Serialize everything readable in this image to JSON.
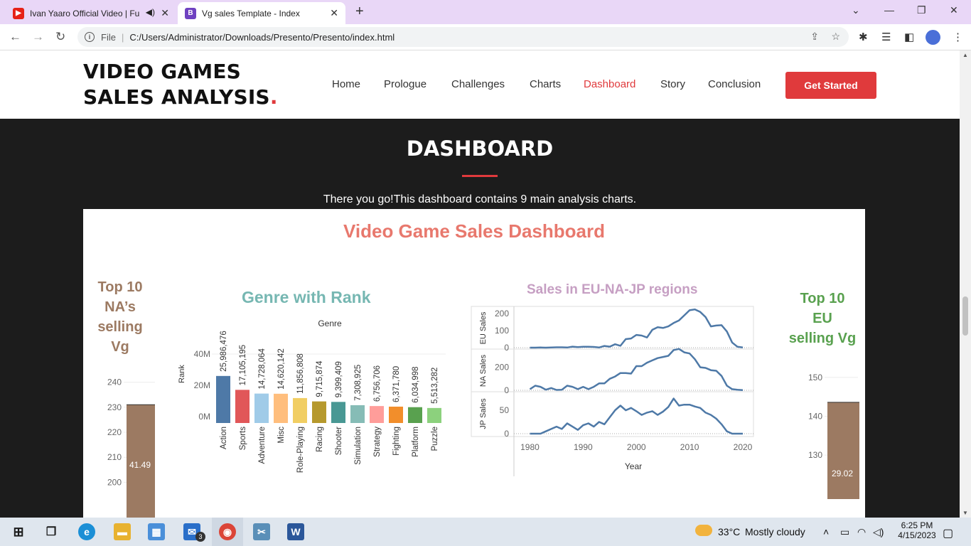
{
  "browser": {
    "tabs": [
      {
        "title": "Ivan Yaaro Official Video | Fu",
        "icon": "youtube-icon",
        "muted_icon": "speaker-icon",
        "active": false
      },
      {
        "title": "Vg sales Template - Index",
        "icon": "bootstrap-icon",
        "icon_letter": "B",
        "active": true
      }
    ],
    "new_tab": "+",
    "address": {
      "scheme_label": "File",
      "url": "C:/Users/Administrator/Downloads/Presento/Presento/index.html"
    }
  },
  "site": {
    "logo_text": "VIDEO GAMES SALES ANALYSIS",
    "logo_dot": ".",
    "nav": [
      {
        "label": "Home",
        "active": false
      },
      {
        "label": "Prologue",
        "active": false
      },
      {
        "label": "Challenges",
        "active": false
      },
      {
        "label": "Charts",
        "active": false
      },
      {
        "label": "Dashboard",
        "active": true
      },
      {
        "label": "Story",
        "active": false
      },
      {
        "label": "Conclusion",
        "active": false
      }
    ],
    "cta_label": "Get Started",
    "section": {
      "title": "DASHBOARD",
      "subtitle": "There you go!This dashboard contains 9 main analysis charts."
    }
  },
  "dashboard": {
    "title": "Video Game Sales Dashboard",
    "colors": {
      "title": "#e8786d",
      "teal": "#76b7b2",
      "purple": "#c69fc3",
      "green": "#59a14f",
      "brown": "#9c7a62",
      "line": "#4e79a7"
    },
    "left_panel": {
      "title": "Top 10 NA's selling Vg",
      "title_lines": [
        "Top 10",
        "NA’s",
        "selling",
        "Vg"
      ]
    },
    "right_panel": {
      "title": "Top 10 EU selling Vg",
      "title_lines": [
        "Top 10",
        "EU",
        "selling Vg"
      ]
    }
  },
  "chart_data": [
    {
      "type": "bar",
      "title": "Top 10 NA’s selling Vg",
      "yticks": [
        "240",
        "230",
        "220",
        "210",
        "200"
      ],
      "ylim": [
        195,
        245
      ],
      "values": [
        231
      ],
      "data_label": "41.49"
    },
    {
      "type": "bar",
      "title": "Genre with Rank",
      "header": "Genre",
      "ylabel": "Rank",
      "yticks": [
        "40M",
        "20M",
        "0M"
      ],
      "ylim": [
        0,
        40000000
      ],
      "categories": [
        "Action",
        "Sports",
        "Adventure",
        "Misc",
        "Role-Playing",
        "Racing",
        "Shooter",
        "Simulation",
        "Strategy",
        "Fighting",
        "Platform",
        "Puzzle"
      ],
      "values": [
        25986476,
        17105195,
        14728064,
        14620142,
        11856808,
        9715874,
        9399409,
        7308925,
        6756706,
        6371780,
        6034998,
        5513282
      ],
      "labels": [
        "25,986,476",
        "17,105,195",
        "14,728,064",
        "14,620,142",
        "11,856,808",
        "9,715,874",
        "9,399,409",
        "7,308,925",
        "6,756,706",
        "6,371,780",
        "6,034,998",
        "5,513,282"
      ],
      "colors": [
        "#4e79a7",
        "#e15759",
        "#a0cbe8",
        "#ffbe7d",
        "#f1ce63",
        "#b6992d",
        "#499894",
        "#86bcb6",
        "#ff9d9a",
        "#f28e2b",
        "#59a14f",
        "#8cd17d"
      ]
    },
    {
      "type": "line",
      "title": "Sales in EU-NA-JP regions",
      "xlabel": "Year",
      "xticks": [
        "1980",
        "1990",
        "2000",
        "2010",
        "2020"
      ],
      "xlim": [
        1977,
        2022
      ],
      "x": [
        1980,
        1981,
        1982,
        1983,
        1984,
        1985,
        1986,
        1987,
        1988,
        1989,
        1990,
        1991,
        1992,
        1993,
        1994,
        1995,
        1996,
        1997,
        1998,
        1999,
        2000,
        2001,
        2002,
        2003,
        2004,
        2005,
        2006,
        2007,
        2008,
        2009,
        2010,
        2011,
        2012,
        2013,
        2014,
        2015,
        2016,
        2017,
        2018,
        2019,
        2020
      ],
      "series": [
        {
          "name": "EU Sales",
          "yticks": [
            "200",
            "100",
            "0"
          ],
          "ylim": [
            0,
            230
          ],
          "values": [
            0,
            0,
            1,
            0,
            1,
            2,
            2,
            1,
            6,
            3,
            5,
            5,
            4,
            1,
            10,
            6,
            20,
            11,
            50,
            54,
            75,
            71,
            60,
            105,
            120,
            116,
            125,
            145,
            160,
            190,
            220,
            225,
            210,
            180,
            125,
            130,
            132,
            95,
            30,
            5,
            1
          ]
        },
        {
          "name": "NA Sales",
          "yticks": [
            "200",
            "0"
          ],
          "ylim": [
            0,
            340
          ],
          "values": [
            10,
            40,
            30,
            5,
            20,
            3,
            5,
            40,
            30,
            10,
            30,
            10,
            30,
            60,
            60,
            100,
            120,
            150,
            150,
            145,
            210,
            210,
            240,
            260,
            280,
            290,
            300,
            350,
            360,
            330,
            320,
            270,
            200,
            195,
            175,
            170,
            125,
            40,
            10,
            5,
            2
          ]
        },
        {
          "name": "JP Sales",
          "yticks": [
            "50",
            "0"
          ],
          "ylim": [
            0,
            85
          ],
          "values": [
            0,
            0,
            0,
            5,
            10,
            15,
            10,
            22,
            15,
            8,
            18,
            22,
            15,
            25,
            20,
            35,
            50,
            60,
            50,
            55,
            48,
            40,
            45,
            48,
            40,
            47,
            57,
            75,
            60,
            62,
            62,
            58,
            55,
            45,
            40,
            32,
            20,
            5,
            0,
            0,
            0
          ]
        }
      ]
    },
    {
      "type": "bar",
      "title": "Top 10 EU selling Vg",
      "yticks": [
        "150",
        "140",
        "130"
      ],
      "ylim": [
        126,
        152
      ],
      "values": [
        143.6
      ],
      "data_label": "29.02"
    }
  ],
  "taskbar": {
    "weather": {
      "temp": "33°C",
      "desc": "Mostly cloudy"
    },
    "time": "6:25 PM",
    "date": "4/15/2023",
    "mail_badge": "3"
  }
}
